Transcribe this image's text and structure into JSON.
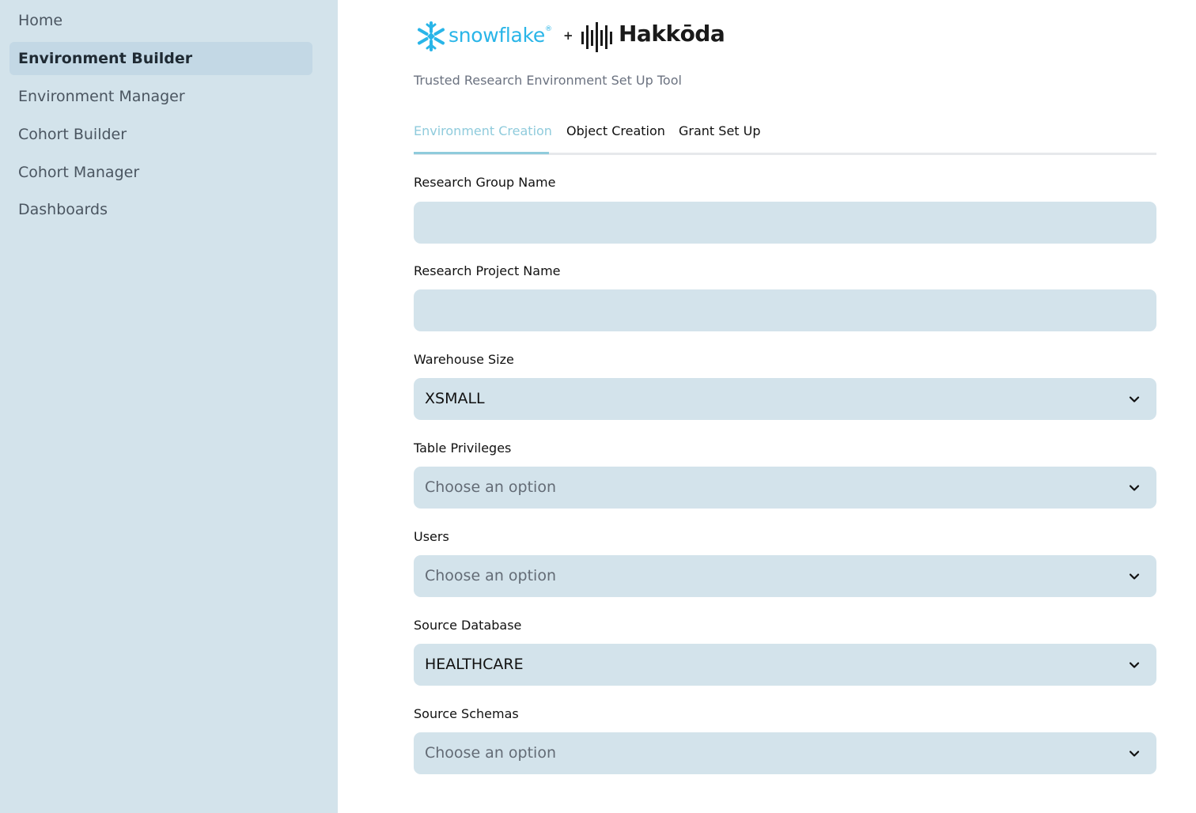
{
  "sidebar": {
    "items": [
      {
        "label": "Home"
      },
      {
        "label": "Environment Builder"
      },
      {
        "label": "Environment Manager"
      },
      {
        "label": "Cohort Builder"
      },
      {
        "label": "Cohort Manager"
      },
      {
        "label": "Dashboards"
      }
    ],
    "active_item": "Environment Builder"
  },
  "header": {
    "logo_snowflake": "snowflake",
    "logo_registered": "®",
    "logo_plus": "+",
    "logo_hakkoda": "Hakkōda",
    "subtitle": "Trusted Research Environment Set Up Tool"
  },
  "tabs": [
    {
      "label": "Environment Creation"
    },
    {
      "label": "Object Creation"
    },
    {
      "label": "Grant Set Up"
    }
  ],
  "active_tab": "Environment Creation",
  "form": {
    "research_group_name": {
      "label": "Research Group Name",
      "value": ""
    },
    "research_project_name": {
      "label": "Research Project Name",
      "value": ""
    },
    "warehouse_size": {
      "label": "Warehouse Size",
      "value": "XSMALL"
    },
    "table_privileges": {
      "label": "Table Privileges",
      "placeholder": "Choose an option"
    },
    "users": {
      "label": "Users",
      "placeholder": "Choose an option"
    },
    "source_database": {
      "label": "Source Database",
      "value": "HEALTHCARE"
    },
    "source_schemas": {
      "label": "Source Schemas",
      "placeholder": "Choose an option"
    }
  },
  "colors": {
    "sidebar_bg": "#d3e3eb",
    "field_bg": "#d3e3eb",
    "active_tab": "#8fcbdc",
    "snowflake_blue": "#29b5e8"
  },
  "icons": {
    "snowflake_logo": "snowflake-icon",
    "hakkoda_logo": "hakkoda-bars-icon",
    "dropdown": "chevron-down-icon"
  }
}
